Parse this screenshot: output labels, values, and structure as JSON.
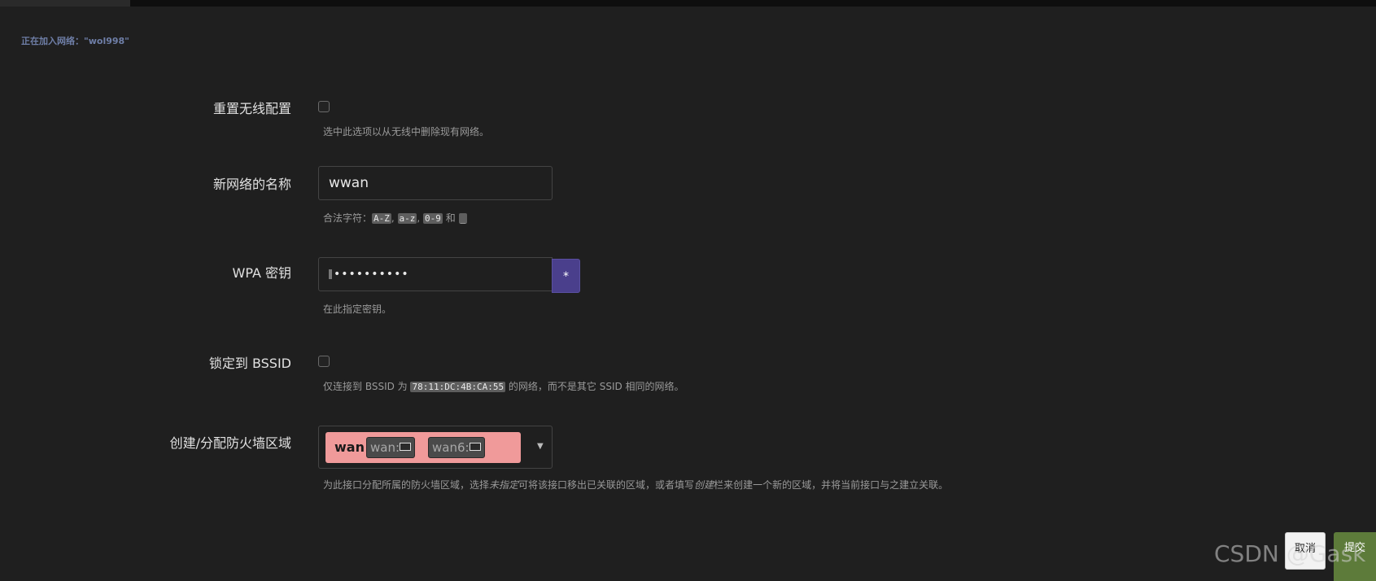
{
  "join_title": "正在加入网络：\"wol998\"",
  "fields": {
    "reset_wireless": {
      "label": "重置无线配置",
      "checked": false,
      "description": "选中此选项以从无线中删除现有网络。"
    },
    "network_name": {
      "label": "新网络的名称",
      "value": "wwan",
      "description_prefix": "合法字符：",
      "chars": [
        "A-Z",
        "a-z",
        "0-9",
        "_"
      ],
      "separator": ", ",
      "and_word": " 和 "
    },
    "wpa_key": {
      "label": "WPA 密钥",
      "masked_value": "••••••••••",
      "reveal_label": "*",
      "description": "在此指定密钥。"
    },
    "lock_bssid": {
      "label": "锁定到 BSSID",
      "checked": false,
      "description_prefix": "仅连接到 BSSID 为 ",
      "bssid": "78:11:DC:4B:CA:55",
      "description_suffix": " 的网络，而不是其它 SSID 相同的网络。"
    },
    "firewall_zone": {
      "label": "创建/分配防火墙区域",
      "zone": "wan",
      "networks": [
        "wan:",
        "wan6:"
      ],
      "zone_color": "#f09a9a",
      "description_part1": "为此接口分配所属的防火墙区域，选择",
      "description_em1": "未指定",
      "description_part2": "可将该接口移出已关联的区域，或者填写",
      "description_em2": "创建",
      "description_part3": "栏来创建一个新的区域，并将当前接口与之建立关联。"
    }
  },
  "buttons": {
    "cancel": "取消",
    "submit": "提交"
  },
  "watermark": "CSDN @Gask",
  "colors": {
    "background": "#1f1f1f",
    "accent_purple": "#4a3f8c",
    "submit_green": "#5d7b3a"
  }
}
